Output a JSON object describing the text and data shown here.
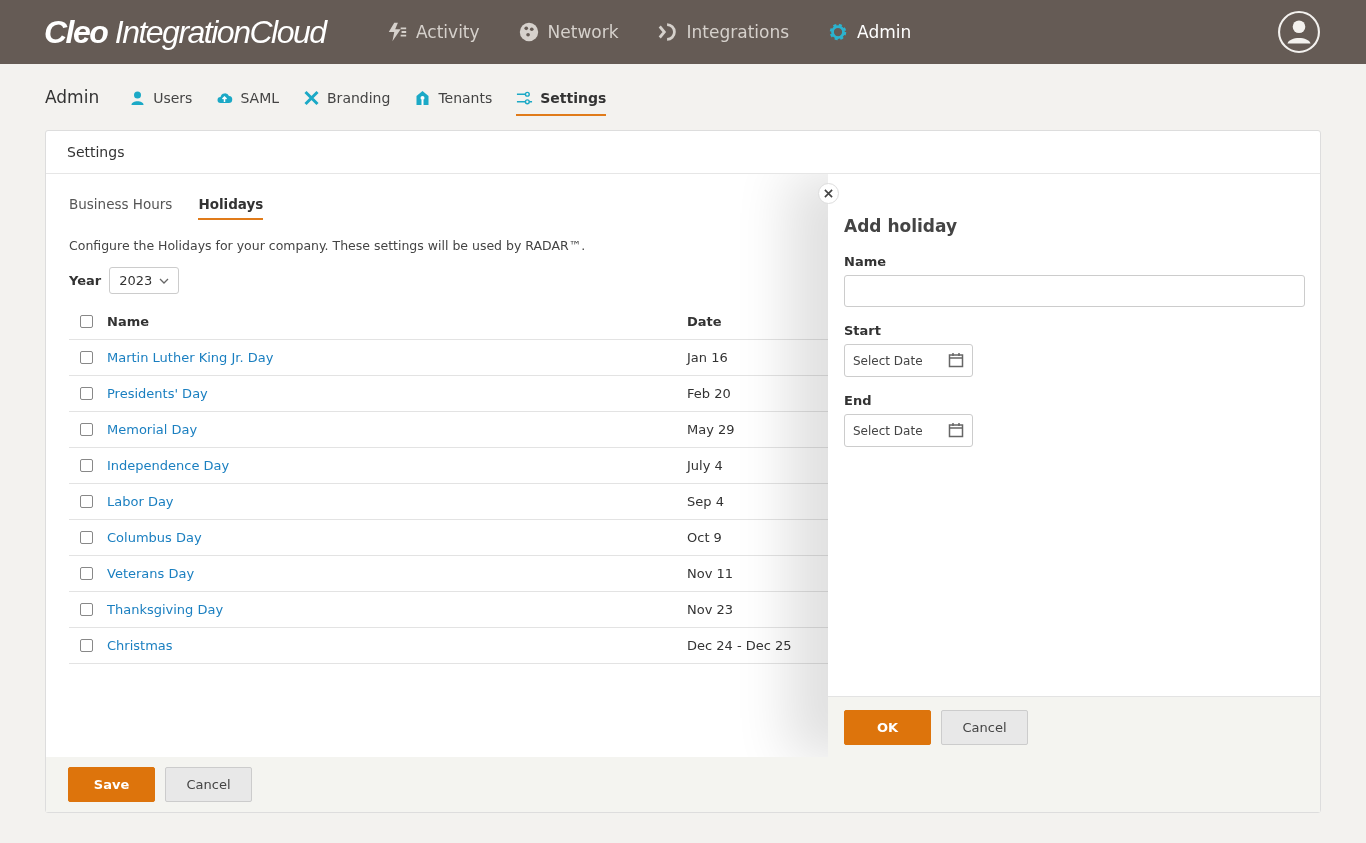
{
  "header": {
    "logo_bold": "Cleo",
    "logo_rest": "IntegrationCloud",
    "nav": [
      {
        "label": "Activity",
        "selected": false
      },
      {
        "label": "Network",
        "selected": false
      },
      {
        "label": "Integrations",
        "selected": false
      },
      {
        "label": "Admin",
        "selected": true
      }
    ]
  },
  "subnav": {
    "title": "Admin",
    "items": [
      {
        "label": "Users",
        "selected": false
      },
      {
        "label": "SAML",
        "selected": false
      },
      {
        "label": "Branding",
        "selected": false
      },
      {
        "label": "Tenants",
        "selected": false
      },
      {
        "label": "Settings",
        "selected": true
      }
    ]
  },
  "card": {
    "title": "Settings",
    "tabs": [
      {
        "label": "Business Hours",
        "selected": false
      },
      {
        "label": "Holidays",
        "selected": true
      }
    ],
    "description": "Configure the Holidays for your company. These settings will be used by RADAR™.",
    "year": {
      "label": "Year",
      "value": "2023"
    },
    "table": {
      "columns": [
        "Name",
        "Date"
      ],
      "all_checked": false,
      "rows": [
        {
          "name": "Martin Luther King Jr. Day",
          "date": "Jan 16",
          "checked": false
        },
        {
          "name": "Presidents' Day",
          "date": "Feb 20",
          "checked": false
        },
        {
          "name": "Memorial Day",
          "date": "May 29",
          "checked": false
        },
        {
          "name": "Independence Day",
          "date": "July 4",
          "checked": false
        },
        {
          "name": "Labor Day",
          "date": "Sep 4",
          "checked": false
        },
        {
          "name": "Columbus Day",
          "date": "Oct 9",
          "checked": false
        },
        {
          "name": "Veterans Day",
          "date": "Nov 11",
          "checked": false
        },
        {
          "name": "Thanksgiving Day",
          "date": "Nov 23",
          "checked": false
        },
        {
          "name": "Christmas",
          "date": "Dec 24 - Dec 25",
          "checked": false
        }
      ]
    },
    "buttons": [
      "Save",
      "Cancel"
    ]
  },
  "drawer": {
    "title": "Add holiday",
    "name_label": "Name",
    "start_label": "Start",
    "start_placeholder": "Select Date",
    "end_label": "End",
    "end_placeholder": "Select Date",
    "buttons": [
      "OK",
      "Cancel"
    ]
  }
}
